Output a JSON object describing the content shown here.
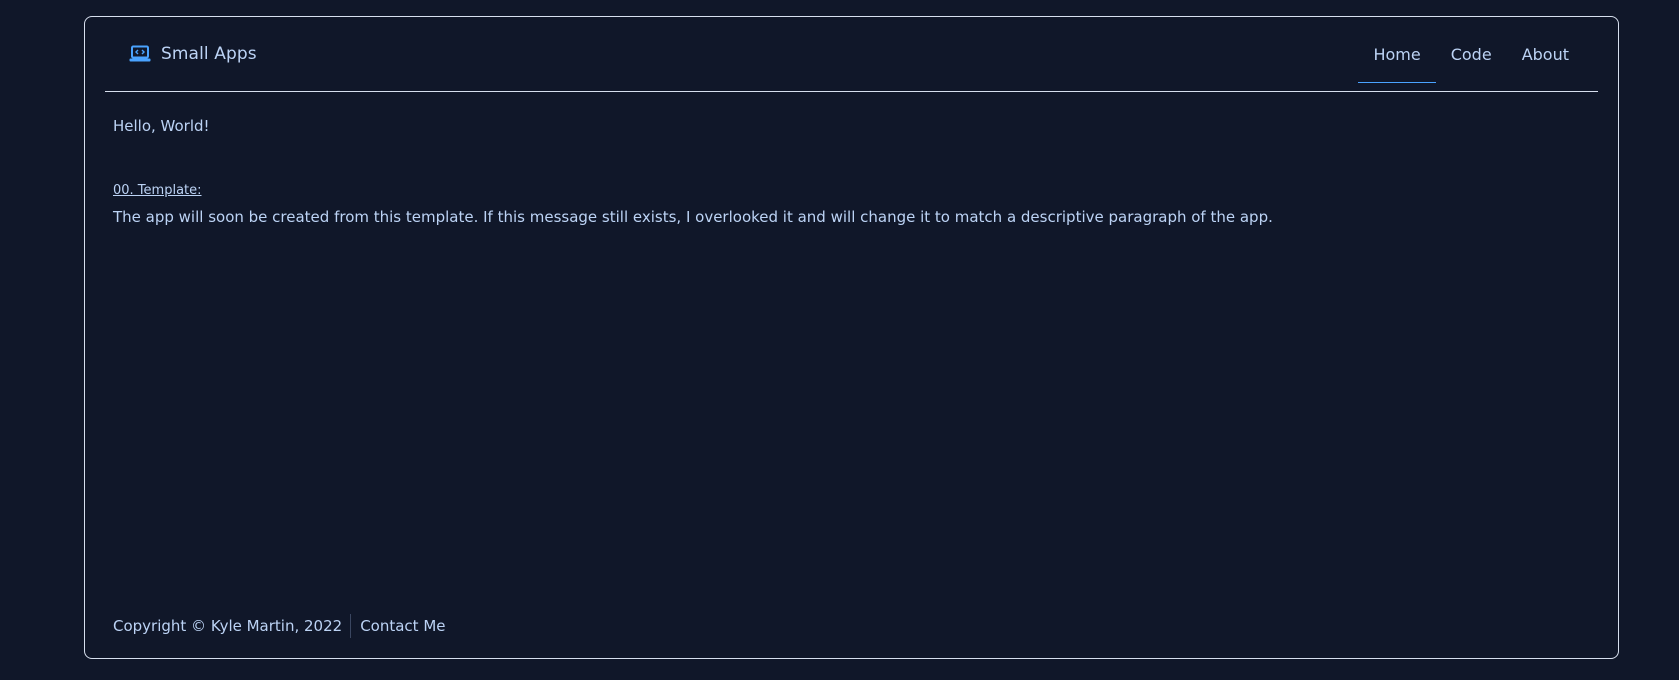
{
  "brand": {
    "icon": "laptop-code-icon",
    "name": "Small Apps",
    "accent_color": "#4aa3ff"
  },
  "nav": {
    "items": [
      {
        "label": "Home",
        "active": true
      },
      {
        "label": "Code",
        "active": false
      },
      {
        "label": "About",
        "active": false
      }
    ]
  },
  "main": {
    "greeting": "Hello, World!",
    "section_link": "00. Template:",
    "description": "The app will soon be created from this template. If this message still exists, I overlooked it and will change it to match a descriptive paragraph of the app."
  },
  "footer": {
    "copyright": "Copyright © Kyle Martin, 2022",
    "contact": "Contact Me"
  },
  "colors": {
    "background": "#101729",
    "text": "#bcd3f5",
    "border": "#d7dfee"
  }
}
